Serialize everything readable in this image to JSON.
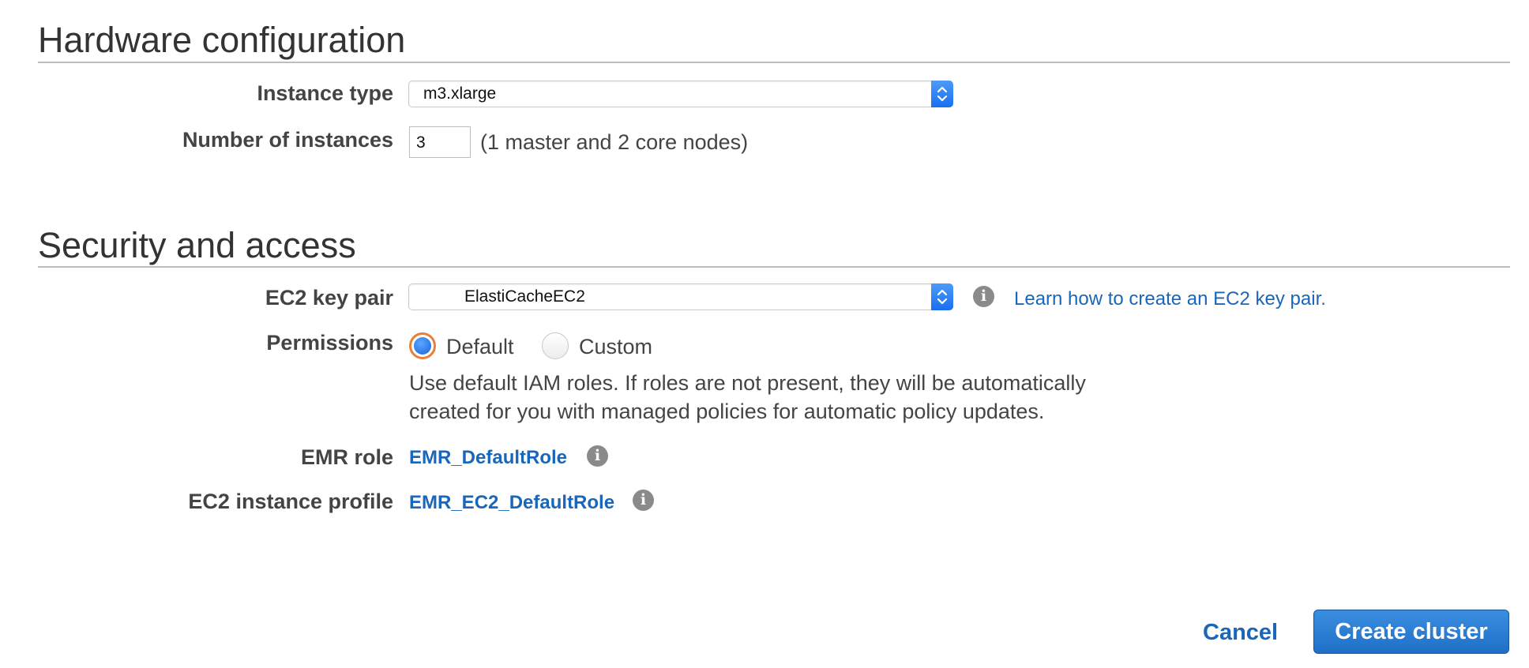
{
  "hardware": {
    "title": "Hardware configuration",
    "instance_type_label": "Instance type",
    "instance_type_value": "m3.xlarge",
    "instances_label": "Number of instances",
    "instances_value": "3",
    "instances_note": "(1 master and 2 core nodes)"
  },
  "security": {
    "title": "Security and access",
    "keypair_label": "EC2 key pair",
    "keypair_value": "ElastiCacheEC2",
    "keypair_link": "Learn how to create an EC2 key pair.",
    "permissions_label": "Permissions",
    "permissions_options": [
      "Default",
      "Custom"
    ],
    "permissions_selected": "Default",
    "permissions_desc_line1": "Use default IAM roles. If roles are not present, they will be automatically",
    "permissions_desc_line2": "created for you with managed policies for automatic policy updates.",
    "emr_role_label": "EMR role",
    "emr_role_value": "EMR_DefaultRole",
    "ec2_profile_label": "EC2 instance profile",
    "ec2_profile_value": "EMR_EC2_DefaultRole"
  },
  "footer": {
    "cancel_label": "Cancel",
    "create_label": "Create cluster"
  },
  "colors": {
    "link": "#1a66b8",
    "primary_button": "#1f6fc7",
    "radio_selected": "#1b63d8",
    "radio_focus_ring": "#e8803a"
  },
  "icons": [
    "info-icon",
    "select-stepper-icon",
    "radio-selected",
    "radio-unselected"
  ]
}
